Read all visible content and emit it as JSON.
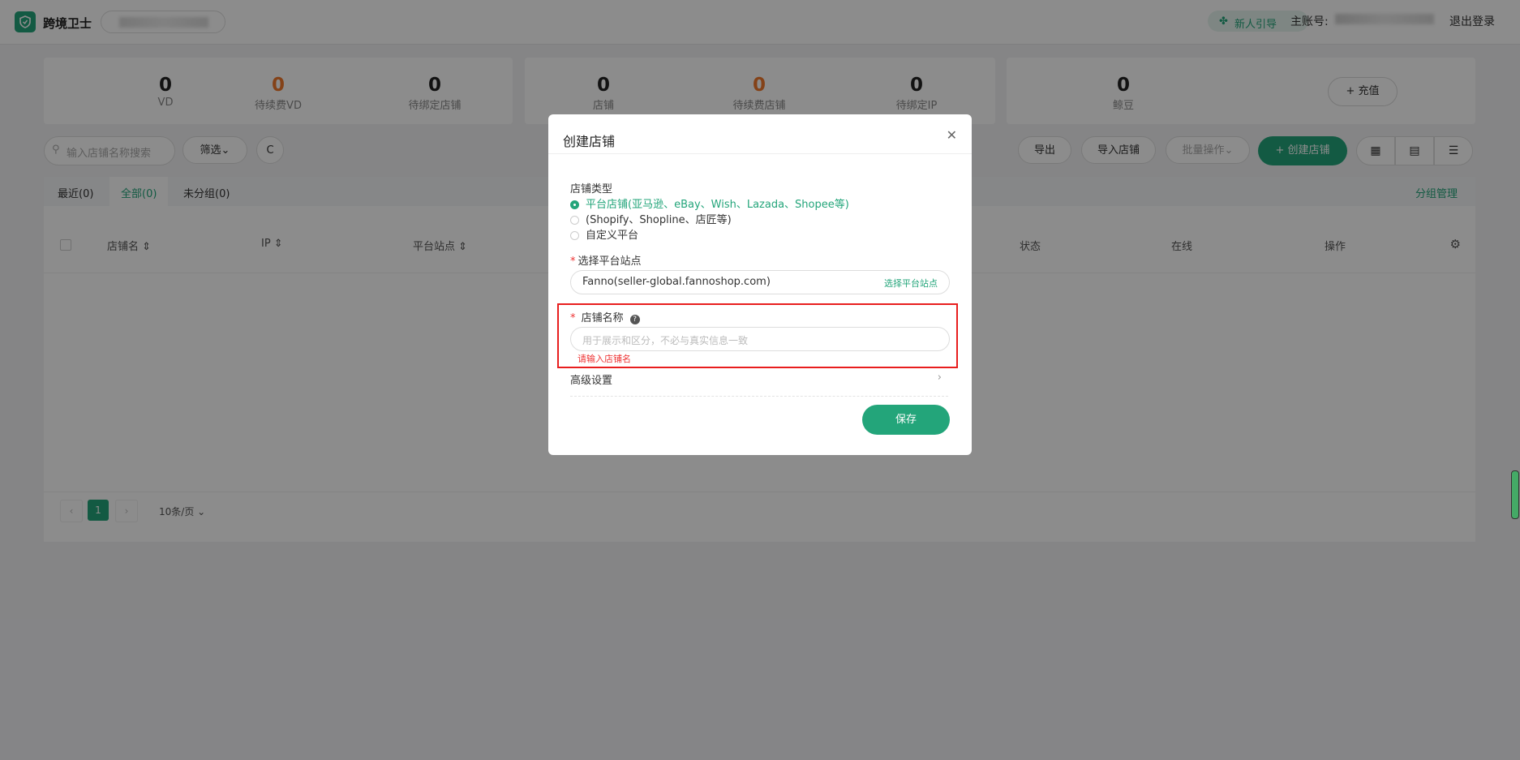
{
  "app": {
    "title": "跨境卫士"
  },
  "header": {
    "guide": "新人引导",
    "main_account_label": "主账号:",
    "logout": "退出登录"
  },
  "stats": [
    {
      "value": "0",
      "label": "VD"
    },
    {
      "value": "0",
      "label": "待续费VD"
    },
    {
      "value": "0",
      "label": "待绑定店铺"
    },
    {
      "value": "0",
      "label": "店铺"
    },
    {
      "value": "0",
      "label": "待续费店铺"
    },
    {
      "value": "0",
      "label": "待绑定IP"
    },
    {
      "value": "0",
      "label": "鲸豆"
    }
  ],
  "recharge": "+ 充值",
  "toolbar": {
    "search_placeholder": "输入店铺名称搜索",
    "filter": "筛选",
    "refresh": "C",
    "export": "导出",
    "import": "导入店铺",
    "batch": "批量操作",
    "create": "+ 创建店铺"
  },
  "tabs": [
    {
      "label": "最近(0)"
    },
    {
      "label": "全部(0)"
    },
    {
      "label": "未分组(0)"
    }
  ],
  "group_mgmt": "分组管理",
  "columns": [
    "店铺名 ⇕",
    "IP ⇕",
    "平台站点 ⇕",
    "状态",
    "在线",
    "操作"
  ],
  "pagination": {
    "page": "1",
    "page_size": "10条/页"
  },
  "modal": {
    "title": "创建店铺",
    "store_type_label": "店铺类型",
    "store_types": [
      {
        "label": "平台店铺(亚马逊、eBay、Wish、Lazada、Shopee等)",
        "selected": true
      },
      {
        "label": "(Shopify、Shopline、店匠等)",
        "selected": false
      },
      {
        "label": "自定义平台",
        "selected": false
      }
    ],
    "site_label": "选择平台站点",
    "site_value": "Fanno(seller-global.fannoshop.com)",
    "site_link": "选择平台站点",
    "name_label": "店铺名称",
    "name_placeholder": "用于展示和区分，不必与真实信息一致",
    "name_error": "请输入店铺名",
    "advanced": "高级设置",
    "save": "保存"
  },
  "colors": {
    "accent": "#23a57a",
    "error": "#e81e1e",
    "warning": "#f0792c"
  }
}
